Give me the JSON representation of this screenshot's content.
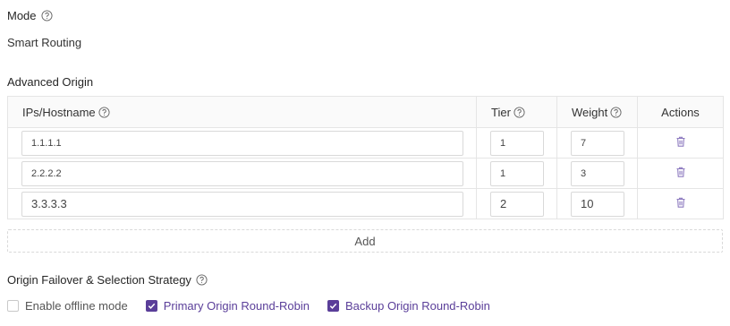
{
  "mode": {
    "label": "Mode",
    "value": "Smart Routing"
  },
  "advanced_origin": {
    "label": "Advanced Origin",
    "columns": {
      "ip": "IPs/Hostname",
      "tier": "Tier",
      "weight": "Weight",
      "actions": "Actions"
    },
    "rows": [
      {
        "ip": "1.1.1.1",
        "tier": "1",
        "weight": "7"
      },
      {
        "ip": "2.2.2.2",
        "tier": "1",
        "weight": "3"
      },
      {
        "ip": "3.3.3.3",
        "tier": "2",
        "weight": "10"
      }
    ],
    "add_label": "Add"
  },
  "failover": {
    "label": "Origin Failover & Selection Strategy",
    "options": [
      {
        "label": "Enable offline mode",
        "checked": false
      },
      {
        "label": "Primary Origin Round-Robin",
        "checked": true
      },
      {
        "label": "Backup Origin Round-Robin",
        "checked": true
      }
    ]
  },
  "colors": {
    "accent": "#5a3e99",
    "border": "#e5e5e5",
    "header_bg": "#fafafa",
    "icon": "#8e7bc0"
  },
  "icons": {
    "help": "question-circle-icon",
    "delete": "trash-icon",
    "check": "checkmark-icon"
  }
}
